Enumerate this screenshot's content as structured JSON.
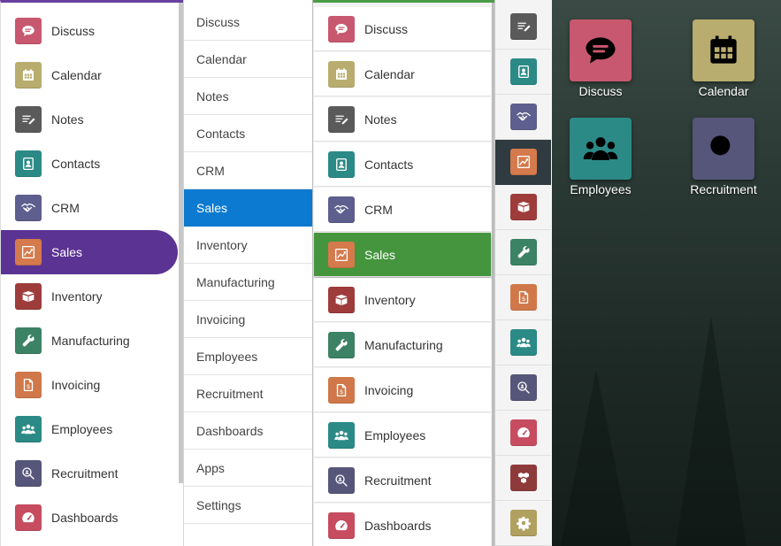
{
  "panel1": {
    "items": [
      {
        "label": "Discuss",
        "icon": "discuss-icon"
      },
      {
        "label": "Calendar",
        "icon": "calendar-icon"
      },
      {
        "label": "Notes",
        "icon": "notes-icon"
      },
      {
        "label": "Contacts",
        "icon": "contacts-icon"
      },
      {
        "label": "CRM",
        "icon": "handshake-icon"
      },
      {
        "label": "Sales",
        "icon": "chart-icon",
        "active": true
      },
      {
        "label": "Inventory",
        "icon": "box-icon"
      },
      {
        "label": "Manufacturing",
        "icon": "wrench-icon"
      },
      {
        "label": "Invoicing",
        "icon": "invoice-icon"
      },
      {
        "label": "Employees",
        "icon": "people-icon"
      },
      {
        "label": "Recruitment",
        "icon": "magnifier-icon"
      },
      {
        "label": "Dashboards",
        "icon": "gauge-icon"
      }
    ],
    "accent": "#5b3393"
  },
  "panel2": {
    "items": [
      "Discuss",
      "Calendar",
      "Notes",
      "Contacts",
      "CRM",
      "Sales",
      "Inventory",
      "Manufacturing",
      "Invoicing",
      "Employees",
      "Recruitment",
      "Dashboards",
      "Apps",
      "Settings"
    ],
    "active": "Sales",
    "accent": "#0b7ad0"
  },
  "panel3": {
    "items": [
      {
        "label": "Discuss",
        "icon": "discuss-icon"
      },
      {
        "label": "Calendar",
        "icon": "calendar-icon"
      },
      {
        "label": "Notes",
        "icon": "notes-icon"
      },
      {
        "label": "Contacts",
        "icon": "contacts-icon"
      },
      {
        "label": "CRM",
        "icon": "handshake-icon"
      },
      {
        "label": "Sales",
        "icon": "chart-icon",
        "active": true
      },
      {
        "label": "Inventory",
        "icon": "box-icon"
      },
      {
        "label": "Manufacturing",
        "icon": "wrench-icon"
      },
      {
        "label": "Invoicing",
        "icon": "invoice-icon"
      },
      {
        "label": "Employees",
        "icon": "people-icon"
      },
      {
        "label": "Recruitment",
        "icon": "magnifier-icon"
      },
      {
        "label": "Dashboards",
        "icon": "gauge-icon"
      }
    ],
    "accent": "#44953d"
  },
  "panel4": {
    "icons": [
      "notes-icon",
      "contacts-icon",
      "handshake-icon",
      "chart-icon",
      "box-icon",
      "wrench-icon",
      "invoice-icon",
      "people-icon",
      "magnifier-icon",
      "gauge-icon",
      "apps-icon",
      "gear-icon"
    ],
    "active": "chart-icon"
  },
  "panel5": {
    "tiles": [
      {
        "label": "Discuss",
        "icon": "discuss-icon"
      },
      {
        "label": "Calendar",
        "icon": "calendar-icon"
      },
      {
        "label": "Employees",
        "icon": "people-icon"
      },
      {
        "label": "Recruitment",
        "icon": "magnifier-icon"
      }
    ]
  }
}
